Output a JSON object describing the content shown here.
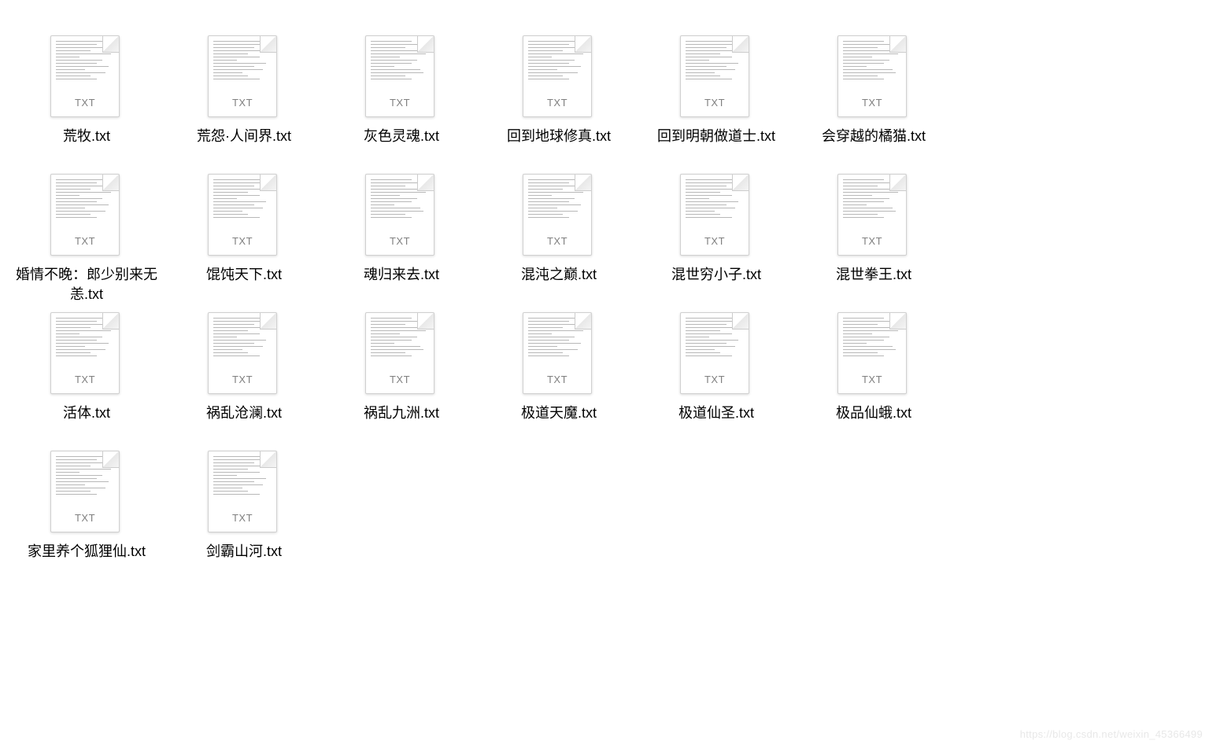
{
  "file_extension_label": "TXT",
  "files": [
    {
      "name": "荒牧.txt"
    },
    {
      "name": "荒怨·人间界.txt"
    },
    {
      "name": "灰色灵魂.txt"
    },
    {
      "name": "回到地球修真.txt"
    },
    {
      "name": "回到明朝做道士.txt"
    },
    {
      "name": "会穿越的橘猫.txt"
    },
    {
      "name": "婚情不晚：郎少别来无恙.txt"
    },
    {
      "name": "馄饨天下.txt"
    },
    {
      "name": "魂归来去.txt"
    },
    {
      "name": "混沌之巅.txt"
    },
    {
      "name": "混世穷小子.txt"
    },
    {
      "name": "混世拳王.txt"
    },
    {
      "name": "活体.txt"
    },
    {
      "name": "祸乱沧澜.txt"
    },
    {
      "name": "祸乱九洲.txt"
    },
    {
      "name": "极道天魔.txt"
    },
    {
      "name": "极道仙圣.txt"
    },
    {
      "name": "极品仙蛾.txt"
    },
    {
      "name": "家里养个狐狸仙.txt"
    },
    {
      "name": "剑霸山河.txt"
    }
  ],
  "watermark": "https://blog.csdn.net/weixin_45366499"
}
